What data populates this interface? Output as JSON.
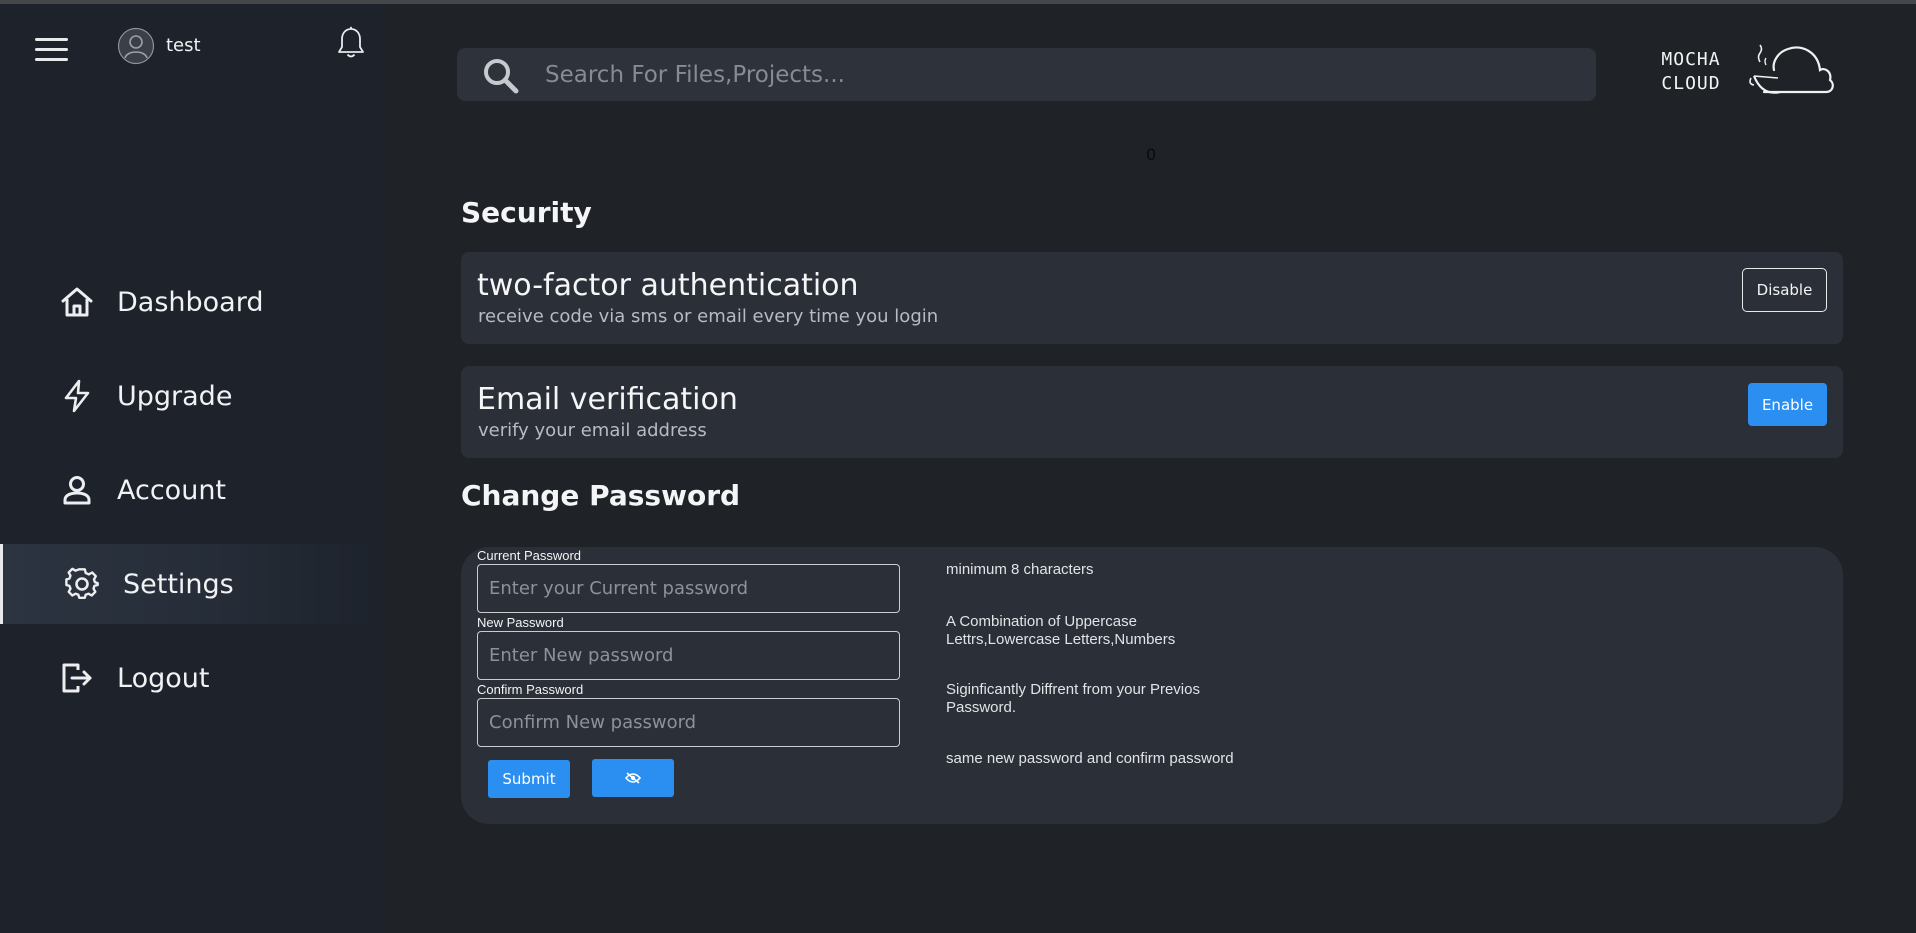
{
  "user": {
    "name": "test"
  },
  "sidebar": {
    "items": [
      {
        "label": "Dashboard",
        "icon": "home-icon"
      },
      {
        "label": "Upgrade",
        "icon": "lightning-icon"
      },
      {
        "label": "Account",
        "icon": "user-icon"
      },
      {
        "label": "Settings",
        "icon": "gear-icon",
        "active": true
      },
      {
        "label": "Logout",
        "icon": "logout-icon"
      }
    ]
  },
  "search": {
    "placeholder": "Search For Files,Projects..."
  },
  "logo": {
    "line1": "MOCHA",
    "line2": "CLOUD"
  },
  "counter": "0",
  "security": {
    "title": "Security",
    "two_factor": {
      "title": "two-factor authentication",
      "subtitle": "receive code via sms or email every time you login",
      "button": "Disable"
    },
    "email_verification": {
      "title": "Email verification",
      "subtitle": "verify your email address",
      "button": "Enable"
    }
  },
  "change_password": {
    "title": "Change Password",
    "current": {
      "label": "Current Password",
      "placeholder": "Enter your Current password"
    },
    "new": {
      "label": "New Password",
      "placeholder": "Enter New password"
    },
    "confirm": {
      "label": "Confirm Password",
      "placeholder": "Confirm New password"
    },
    "submit": "Submit",
    "toggle_icon": "eye-slash-icon",
    "rules": [
      "minimum 8 characters",
      "A Combination of Uppercase Lettrs,Lowercase Letters,Numbers",
      "Siginficantly Diffrent from your Previos Password.",
      "same new password and confirm password"
    ]
  },
  "colors": {
    "accent": "#2b8ff2",
    "sidebar_bg": "#1d222b",
    "main_bg": "#1f2227",
    "card_bg": "#2b2f37"
  }
}
